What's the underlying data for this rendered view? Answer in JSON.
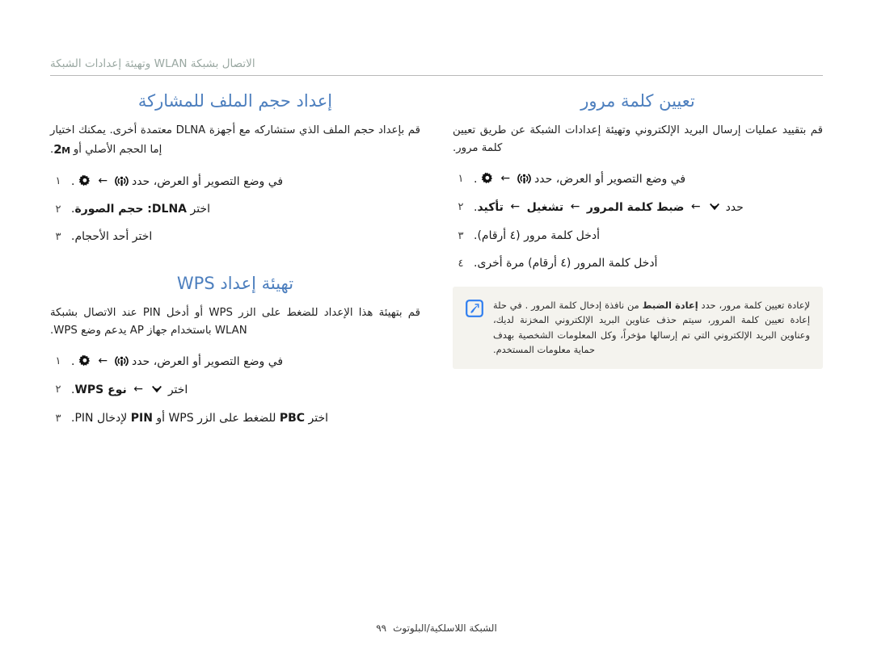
{
  "header": {
    "running_title": "الاتصال بشبكة WLAN وتهيئة إعدادات الشبكة"
  },
  "left_column": {
    "title": "تعيين كلمة مرور",
    "intro": "قم بتقييد عمليات إرسال البريد الإلكتروني وتهيئة إعدادات الشبكة عن طريق تعيين كلمة مرور.",
    "steps": [
      {
        "num": "١",
        "pre": "في وضع التصوير أو العرض، حدد",
        "icon1": "wifi-signal-icon",
        "arrow": "←",
        "icon2": "gear-icon",
        "post": "."
      },
      {
        "num": "٢",
        "pre": "حدد",
        "icon1": "chevron-down-icon",
        "bold1": "ضبط كلمة المرور",
        "bold2": "تشغيل",
        "bold3": "تأكيد",
        "arrow": "←",
        "post": "."
      },
      {
        "num": "٣",
        "text": "أدخل كلمة مرور (٤ أرقام)."
      },
      {
        "num": "٤",
        "text": "أدخل كلمة المرور (٤ أرقام) مرة أخرى."
      }
    ],
    "note": {
      "icon": "note-pen-icon",
      "part1": "لإعادة تعيين كلمة مرور، حدد",
      "bold": "إعادة الضبط",
      "part2": "من نافذة إدخال كلمة المرور . في حلة إعادة تعيين كلمة المرور، سيتم حذف عناوين البريد الإلكتروني المخزنة لديك، وعناوين البريد الإلكتروني التي تم إرسالها مؤخراً، وكل المعلومات الشخصية بهدف حماية معلومات المستخدم."
    }
  },
  "right_column": {
    "section1": {
      "title": "إعداد حجم الملف للمشاركة",
      "intro_a": "قم بإعداد حجم الملف الذي ستشاركه مع أجهزة DLNA معتمدة أخرى. يمكنك اختيار إما الحجم الأصلي أو",
      "size_tag": "2",
      "size_tag_sub": "M",
      "intro_b": ".",
      "steps": [
        {
          "num": "١",
          "pre": "في وضع التصوير أو العرض، حدد",
          "icon1": "wifi-signal-icon",
          "arrow": "←",
          "icon2": "gear-icon",
          "post": "."
        },
        {
          "num": "٢",
          "pre": "اختر",
          "bold": "DLNA: حجم الصورة",
          "post": "."
        },
        {
          "num": "٣",
          "text": "اختر أحد الأحجام."
        }
      ]
    },
    "section2": {
      "title": "تهيئة إعداد WPS",
      "intro": "قم بتهيئة هذا الإعداد للضغط على الزر WPS أو أدخل PIN عند الاتصال بشبكة WLAN باستخدام جهاز AP يدعم وضع WPS.",
      "steps": [
        {
          "num": "١",
          "pre": "في وضع التصوير أو العرض، حدد",
          "icon1": "wifi-signal-icon",
          "arrow": "←",
          "icon2": "gear-icon",
          "post": "."
        },
        {
          "num": "٢",
          "pre": "اختر",
          "icon1": "chevron-down-icon",
          "arrow": "←",
          "bold": "نوع WPS",
          "post": "."
        },
        {
          "num": "٣",
          "pre": "اختر",
          "bold": "PBC",
          "mid": "للضغط على الزر WPS أو",
          "bold2": "PIN",
          "post": "لإدخال PIN."
        }
      ]
    }
  },
  "footer": {
    "text": "الشبكة اللاسلكية/البلوتوث",
    "page_number": "٩٩"
  },
  "colors": {
    "heading": "#4d7fbe",
    "running_header": "#9aa8a2",
    "note_bg": "#f4f3ee",
    "note_icon": "#2f7ef0",
    "rule": "#b9b9b9"
  }
}
